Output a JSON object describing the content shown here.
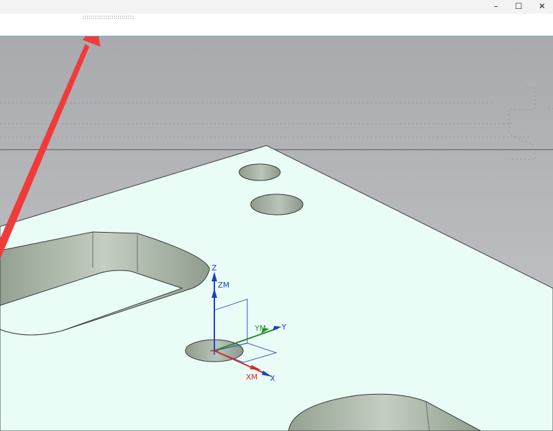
{
  "window": {
    "minimize_glyph": "–",
    "maximize_glyph": "☐",
    "close_glyph": "✕"
  },
  "csys": {
    "z_label": "Z",
    "zm_label": "ZM",
    "y_label": "Y",
    "ym_label": "YM",
    "x_label": "X",
    "xm_label": "XM"
  },
  "colors": {
    "background_top": "#a9aaad",
    "background_bottom": "#c8c9cc",
    "part_face": "#e9fcf6",
    "hole_wall": "#9fab9f",
    "x_axis": "#d42b2b",
    "y_axis": "#2a8a2a",
    "z_axis": "#1f3fc0",
    "annotation_arrow": "#f03b3b"
  }
}
